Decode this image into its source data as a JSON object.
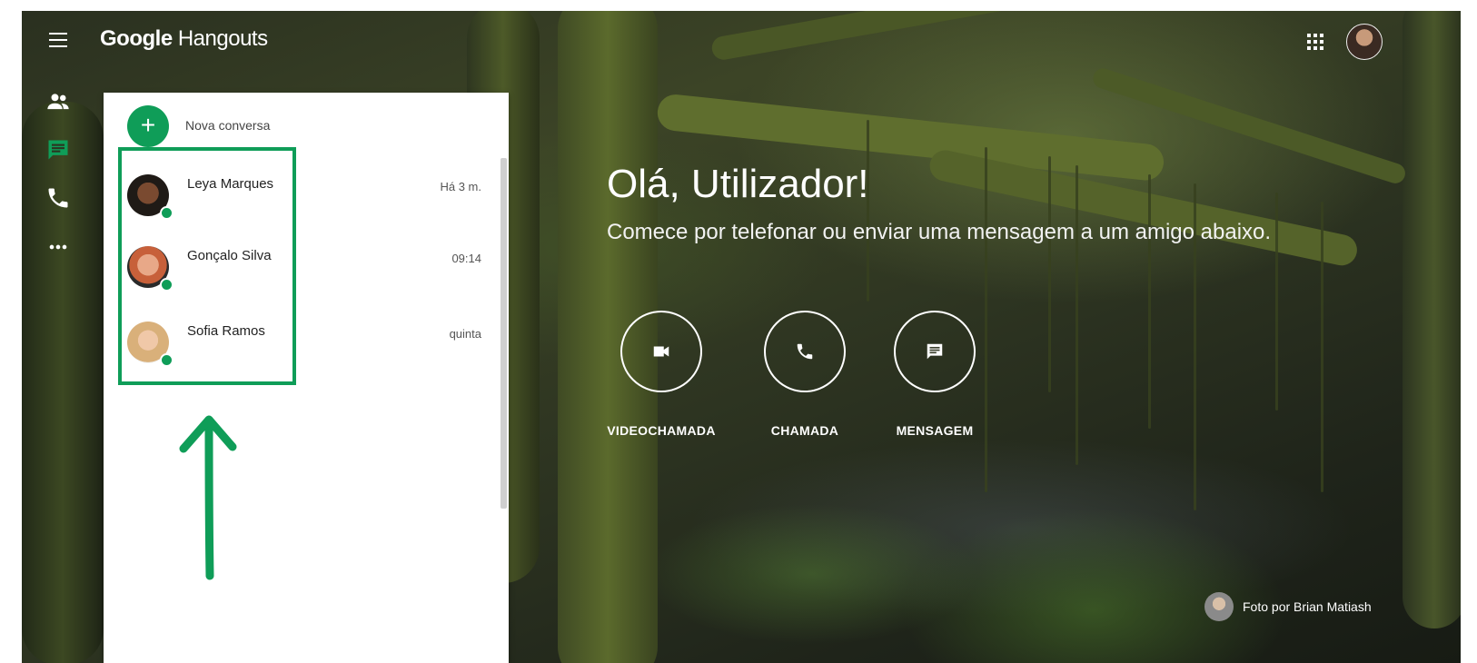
{
  "app": {
    "brand_google": "Google",
    "brand_product": "Hangouts"
  },
  "icons": {
    "menu": "menu-icon",
    "apps": "apps-grid-icon",
    "rail": [
      "people-icon",
      "chat-icon",
      "phone-icon",
      "more-horizontal-icon"
    ],
    "actions": [
      "videocam-icon",
      "phone-icon",
      "message-icon"
    ]
  },
  "colors": {
    "accent": "#0f9d58",
    "panel_bg": "#ffffff",
    "rail_icon": "#ffffff",
    "rail_icon_active": "#0f9d58"
  },
  "sidebar": {
    "new_conversation": "Nova conversa",
    "conversations": [
      {
        "name": "Leya Marques",
        "time": "Há 3 m.",
        "online": true
      },
      {
        "name": "Gonçalo Silva",
        "time": "09:14",
        "online": true
      },
      {
        "name": "Sofia Ramos",
        "time": "quinta",
        "online": true
      }
    ]
  },
  "main": {
    "greeting": "Olá, Utilizador!",
    "subtitle": "Comece por telefonar ou enviar uma mensagem a um amigo abaixo.",
    "actions": [
      {
        "label": "VIDEOCHAMADA"
      },
      {
        "label": "CHAMADA"
      },
      {
        "label": "MENSAGEM"
      }
    ]
  },
  "credit": {
    "text": "Foto por Brian Matiash"
  }
}
